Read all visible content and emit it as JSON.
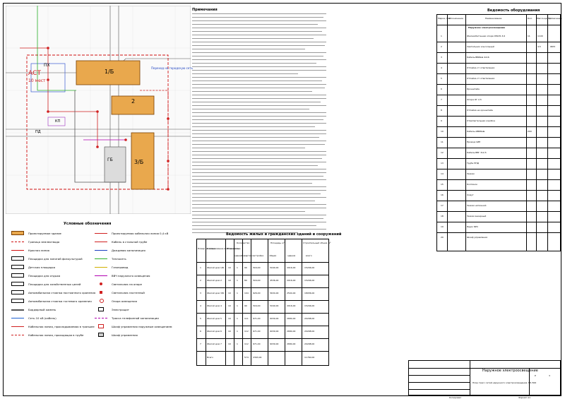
{
  "notes": {
    "heading": "Примечания",
    "line_count": 46
  },
  "plan": {
    "label_ast": "АСТ",
    "label_park": "10 мест",
    "label_pkh": "ПХ",
    "label_pd": "ПД",
    "label_kp": "КП",
    "label_1b": "1/Б",
    "label_2": "2",
    "label_3b": "3/Б",
    "label_gb": "ГБ",
    "label_pd2": "ПД",
    "label_pd3": "ПД",
    "label_note": "Переход на городскую сеть"
  },
  "legend": {
    "title": "Условные обозначения",
    "left": [
      "Проектируемое здание",
      "Граница землеотвода",
      "Красная линия",
      "Площадка для занятий физкультурой",
      "Детская площадка",
      "Площадка для отдыха",
      "Площадка для хозяйственных целей",
      "Автомобильная стоянка постоянного хранения",
      "Автомобильная стоянка гостевого хранения",
      "Бордюрный камень",
      "Сеть 10 кВ (кабель)",
      "Кабельная линия, прокладываемая в траншее",
      "Кабельная линия, проходящая в трубе"
    ],
    "right": [
      "Проектируемая кабельная линия 0,4 кВ",
      "Кабель в стальной трубе",
      "Дождевая канализация",
      "Теплосеть",
      "Газопровод",
      "ВВЧ наружного освещения",
      "Светильник на опоре",
      "Светильник настенный",
      "Опора освещения",
      "Электрощит",
      "Трасса телефонной канализации",
      "Шкаф управления наружным освещением",
      "Шкаф управления"
    ]
  },
  "table": {
    "title": "Ведомость жилых и гражданских зданий и сооружений",
    "headers": [
      "Номер на плане",
      "Наименование и обозначение",
      "Этажность",
      "Количество",
      "Площадь, м²",
      "Строительный объем, м³"
    ],
    "subheaders": [
      "зданий",
      "квартир",
      "застройки",
      "общая",
      "здания",
      "всего"
    ],
    "rows": [
      [
        "1",
        "Жилой дом 1/Б",
        "10",
        "1",
        "90",
        "504,00",
        "5040,00",
        "2016,00",
        "15246,00"
      ],
      [
        "2",
        "Жилой дом 2",
        "10",
        "1",
        "80",
        "504,00",
        "4536,00",
        "2016,00",
        "15246,00"
      ],
      [
        "3",
        "Жилой дом 3/Б",
        "10",
        "1",
        "104",
        "626,00",
        "5634,00",
        "2504,00",
        "18936,00"
      ],
      [
        "4",
        "Жилой дом 4",
        "10",
        "1",
        "90",
        "504,00",
        "5040,00",
        "2016,00",
        "15246,00"
      ],
      [
        "5",
        "Жилой дом 5",
        "10",
        "1",
        "111",
        "671,00",
        "6039,00",
        "2684,00",
        "20298,00"
      ],
      [
        "6",
        "Жилой дом 6",
        "10",
        "1",
        "112",
        "671,00",
        "6039,00",
        "2684,00",
        "20298,00"
      ],
      [
        "7",
        "Жилой дом 7",
        "10",
        "1",
        "112",
        "671,00",
        "6039,00",
        "2684,00",
        "20298,00"
      ],
      [
        "",
        "Всего",
        "",
        "",
        "574",
        "2363,00",
        "",
        "",
        "11760,00"
      ]
    ]
  },
  "spec": {
    "title": "Ведомость оборудования",
    "headers": [
      "Марка, поз.",
      "Обозначение",
      "Наименование",
      "Кол.",
      "Масса ед., кг",
      "Примечание"
    ],
    "section": "Наружное электроосвещение",
    "rows": [
      [
        "1",
        "",
        "Железобетонная опора СВ105-3,6",
        "11",
        "1100",
        ""
      ],
      [
        "2",
        "",
        "Светильник консольный",
        "",
        "4,5",
        "ЖКУ"
      ],
      [
        "3",
        "",
        "Кабель ВБбШв 4х16",
        "",
        "",
        ""
      ],
      [
        "4",
        "",
        "Отпайка от ответвления",
        "",
        "",
        ""
      ],
      [
        "5",
        "",
        "Отпайка от ответвления",
        "",
        "",
        ""
      ],
      [
        "6",
        "",
        "Кронштейн",
        "",
        "",
        ""
      ],
      [
        "7",
        "",
        "Опора ОГ 2,5",
        "",
        "",
        ""
      ],
      [
        "8",
        "",
        "Отпайка на кронштейн",
        "",
        "",
        ""
      ],
      [
        "9",
        "",
        "Ответвительная коробка",
        "",
        "",
        ""
      ],
      [
        "10",
        "",
        "Кабель АВБбШв",
        "200",
        "",
        ""
      ],
      [
        "11",
        "",
        "Провод СИП",
        "",
        "",
        ""
      ],
      [
        "12",
        "",
        "Кабель ВВГ 3х2,5",
        "",
        "",
        ""
      ],
      [
        "13",
        "",
        "Труба ПНД",
        "",
        "",
        ""
      ],
      [
        "14",
        "",
        "Зажим",
        "",
        "",
        ""
      ],
      [
        "15",
        "",
        "Колпачок",
        "",
        "",
        ""
      ],
      [
        "16",
        "",
        "Хомут",
        "",
        "",
        ""
      ],
      [
        "17",
        "",
        "Зажим натяжной",
        "",
        "",
        ""
      ],
      [
        "18",
        "",
        "Зажим анкерный",
        "",
        "",
        ""
      ],
      [
        "19",
        "",
        "Ящик ЯУО",
        "",
        "",
        ""
      ],
      [
        "20",
        "",
        "Шкаф управления",
        "",
        "",
        ""
      ]
    ]
  },
  "stamp": {
    "title": "Наружное электроосвещение",
    "subtitle": "План трасс сетей наружного электроосвещения. М1:500",
    "stage": "Р",
    "sheet": "3",
    "format": "Формат А1",
    "copied": "Копировал"
  }
}
